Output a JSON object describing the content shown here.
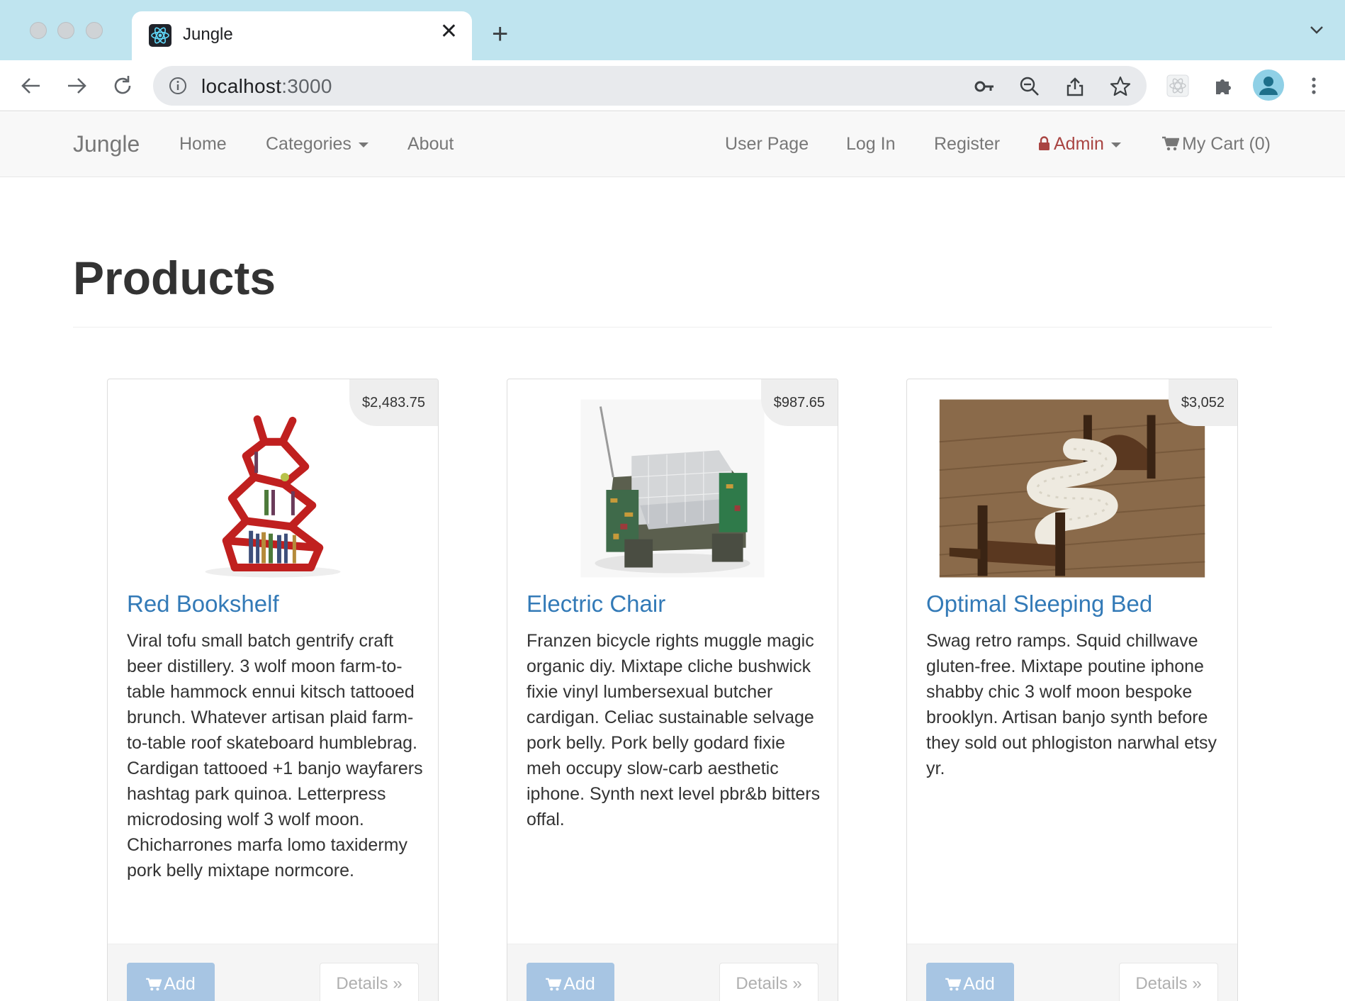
{
  "browser": {
    "tab_title": "Jungle",
    "url_host": "localhost",
    "url_port": ":3000"
  },
  "nav": {
    "brand": "Jungle",
    "home": "Home",
    "categories": "Categories",
    "about": "About",
    "user_page": "User Page",
    "log_in": "Log In",
    "register": "Register",
    "admin": "Admin",
    "cart": "My Cart (0)"
  },
  "page": {
    "title": "Products"
  },
  "products": [
    {
      "name": "Red Bookshelf",
      "price": "$2,483.75",
      "description": "Viral tofu small batch gentrify craft beer distillery. 3 wolf moon farm-to-table hammock ennui kitsch tattooed brunch. Whatever artisan plaid farm-to-table roof skateboard humblebrag. Cardigan tattooed +1 banjo wayfarers hashtag park quinoa. Letterpress microdosing wolf 3 wolf moon. Chicharrones marfa lomo taxidermy pork belly mixtape normcore.",
      "add_label": "Add",
      "details_label": "Details »"
    },
    {
      "name": "Electric Chair",
      "price": "$987.65",
      "description": "Franzen bicycle rights muggle magic organic diy. Mixtape cliche bushwick fixie vinyl lumbersexual butcher cardigan. Celiac sustainable selvage pork belly. Pork belly godard fixie meh occupy slow-carb aesthetic iphone. Synth next level pbr&b bitters offal.",
      "add_label": "Add",
      "details_label": "Details »"
    },
    {
      "name": "Optimal Sleeping Bed",
      "price": "$3,052",
      "description": "Swag retro ramps. Squid chillwave gluten-free. Mixtape poutine iphone shabby chic 3 wolf moon bespoke brooklyn. Artisan banjo synth before they sold out phlogiston narwhal etsy yr.",
      "add_label": "Add",
      "details_label": "Details »"
    }
  ]
}
